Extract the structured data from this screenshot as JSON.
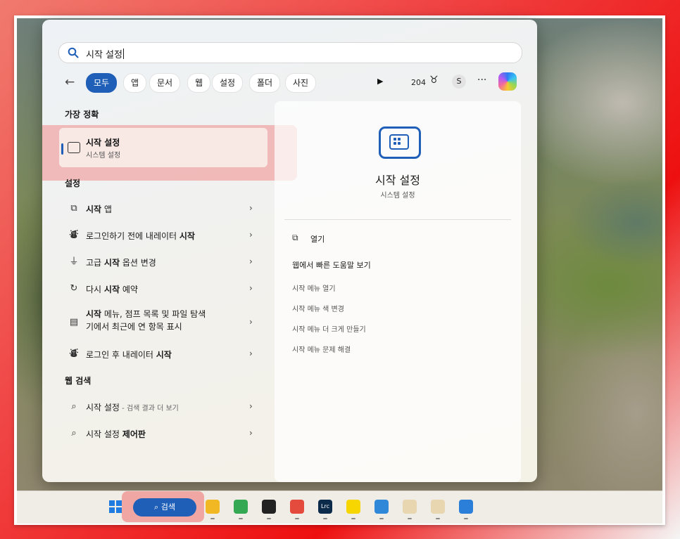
{
  "search": {
    "query": "시작 설정"
  },
  "filters": {
    "chips": [
      "모두",
      "앱",
      "문서",
      "웹",
      "설정",
      "폴더",
      "사진"
    ],
    "active": 0,
    "points": "204",
    "avatar_initial": "S",
    "more": "···"
  },
  "results": {
    "best_match_header": "가장 정확",
    "best_match": {
      "title": "시작 설정",
      "subtitle": "시스템 설정"
    },
    "settings_header": "설정",
    "settings_items": [
      {
        "icon": "start-apps-icon",
        "pre": "",
        "bold": "시작",
        "post": " 앱",
        "line2": ""
      },
      {
        "icon": "narrator-icon",
        "pre": "로그인하기 전에 내레이터 ",
        "bold": "시작",
        "post": "",
        "line2": ""
      },
      {
        "icon": "advanced-startup-icon",
        "pre": "고급 ",
        "bold": "시작",
        "post": " 옵션 변경",
        "line2": ""
      },
      {
        "icon": "restart-icon",
        "pre": "다시 ",
        "bold": "시작",
        "post": " 예약",
        "line2": ""
      },
      {
        "icon": "start-menu-icon",
        "pre": "",
        "bold": "시작",
        "post": " 메뉴, 점프 목록 및 파일 탐색",
        "line2": "기에서 최근에 연 항목 표시"
      },
      {
        "icon": "narrator-icon",
        "pre": "로그인 후 내레이터 ",
        "bold": "시작",
        "post": "",
        "line2": ""
      }
    ],
    "web_header": "웹 검색",
    "web_items": [
      {
        "pre": "시작 설정",
        "bold": "",
        "suffix": " - 검색 결과 더 보기"
      },
      {
        "pre": "시작 설정 ",
        "bold": "제어판",
        "suffix": ""
      }
    ]
  },
  "preview": {
    "title": "시작 설정",
    "subtitle": "시스템 설정",
    "open_label": "열기",
    "help_header": "웹에서 빠른 도움말 보기",
    "help_links": [
      "시작 메뉴 열기",
      "시작 메뉴 색 변경",
      "시작 메뉴 더 크게 만들기",
      "시작 메뉴 문제 해결"
    ]
  },
  "taskbar": {
    "search_label": "검색",
    "apps": [
      {
        "name": "file-explorer-icon",
        "color": "#f2b824",
        "glyph": ""
      },
      {
        "name": "chrome-icon",
        "color": "#34a853",
        "glyph": ""
      },
      {
        "name": "camera-app-icon",
        "color": "#222222",
        "glyph": ""
      },
      {
        "name": "creative-cloud-icon",
        "color": "#e44b3c",
        "glyph": ""
      },
      {
        "name": "lightroom-classic-icon",
        "color": "#0c2a4a",
        "glyph": "Lrc"
      },
      {
        "name": "kakaotalk-icon",
        "color": "#f7d600",
        "glyph": ""
      },
      {
        "name": "notepad-icon",
        "color": "#2f89d8",
        "glyph": ""
      },
      {
        "name": "character-app-icon",
        "color": "#e8d6b0",
        "glyph": ""
      },
      {
        "name": "character-app-2-icon",
        "color": "#e8d6b0",
        "glyph": ""
      },
      {
        "name": "photos-icon",
        "color": "#2b7fd9",
        "glyph": ""
      }
    ]
  }
}
